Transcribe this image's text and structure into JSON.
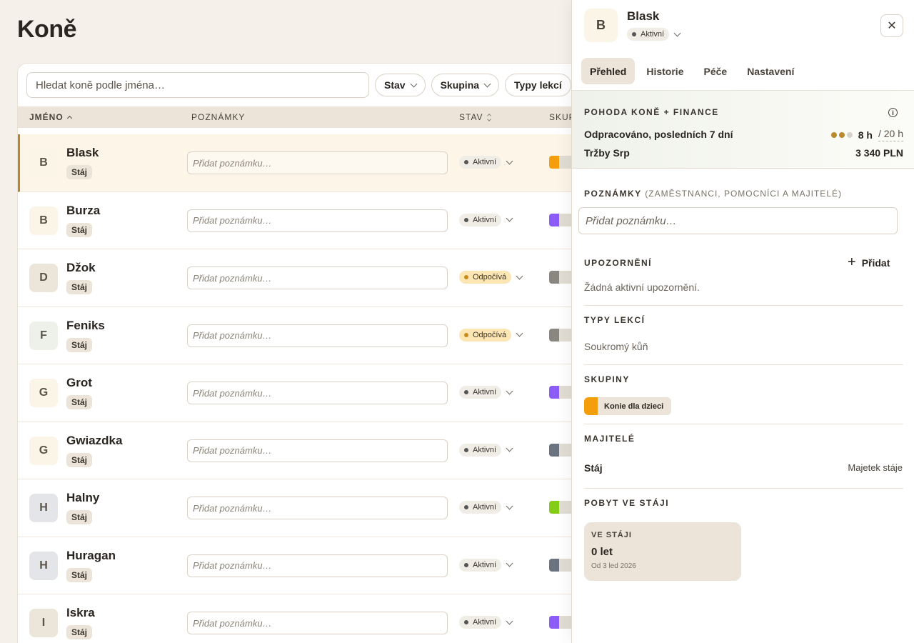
{
  "page": {
    "title": "Koně"
  },
  "toolbar": {
    "search_placeholder": "Hledat koně podle jména…",
    "filters": [
      "Stav",
      "Skupina",
      "Typy lekcí"
    ]
  },
  "table": {
    "headers": {
      "name": "JMÉNO",
      "notes": "POZNÁMKY",
      "status": "STAV",
      "group": "SKUP"
    },
    "note_placeholder": "Přidat poznámku…",
    "rows": [
      {
        "initial": "B",
        "name": "Blask",
        "tag": "Stáj",
        "status": "Aktivní",
        "status_kind": "active",
        "avatar_color": "#fbf5e7",
        "group_color": "#f59e0b",
        "selected": true
      },
      {
        "initial": "B",
        "name": "Burza",
        "tag": "Stáj",
        "status": "Aktivní",
        "status_kind": "active",
        "avatar_color": "#fbf5e7",
        "group_color": "#8b5cf6",
        "selected": false
      },
      {
        "initial": "D",
        "name": "Džok",
        "tag": "Stáj",
        "status": "Odpočívá",
        "status_kind": "rest",
        "avatar_color": "#ebe5da",
        "group_color": "#8a8680",
        "selected": false
      },
      {
        "initial": "F",
        "name": "Feniks",
        "tag": "Stáj",
        "status": "Odpočívá",
        "status_kind": "rest",
        "avatar_color": "#eef1ea",
        "group_color": "#8a8680",
        "selected": false
      },
      {
        "initial": "G",
        "name": "Grot",
        "tag": "Stáj",
        "status": "Aktivní",
        "status_kind": "active",
        "avatar_color": "#fbf5e7",
        "group_color": "#8b5cf6",
        "selected": false
      },
      {
        "initial": "G",
        "name": "Gwiazdka",
        "tag": "Stáj",
        "status": "Aktivní",
        "status_kind": "active",
        "avatar_color": "#fbf5e7",
        "group_color": "#6b7280",
        "selected": false
      },
      {
        "initial": "H",
        "name": "Halny",
        "tag": "Stáj",
        "status": "Aktivní",
        "status_kind": "active",
        "avatar_color": "#e3e5e8",
        "group_color": "#84cc16",
        "selected": false
      },
      {
        "initial": "H",
        "name": "Huragan",
        "tag": "Stáj",
        "status": "Aktivní",
        "status_kind": "active",
        "avatar_color": "#e3e5e8",
        "group_color": "#6b7280",
        "selected": false
      },
      {
        "initial": "I",
        "name": "Iskra",
        "tag": "Stáj",
        "status": "Aktivní",
        "status_kind": "active",
        "avatar_color": "#ebe5da",
        "group_color": "#8b5cf6",
        "selected": false
      }
    ]
  },
  "panel": {
    "initial": "B",
    "name": "Blask",
    "status": "Aktivní",
    "close": "✕",
    "tabs": [
      "Přehled",
      "Historie",
      "Péče",
      "Nastavení"
    ],
    "finance": {
      "title": "POHODA KONĚ + FINANCE",
      "worked_label": "Odpracováno, posledních 7 dní",
      "worked_value": "8 h",
      "worked_of": "/ 20 h",
      "sales_label": "Tržby Srp",
      "sales_value": "3 340 PLN"
    },
    "notes": {
      "title": "POZNÁMKY",
      "subtitle": "(ZAMĚSTNANCI, POMOCNÍCI A MAJITELÉ)",
      "placeholder": "Přidat poznámku…"
    },
    "alerts": {
      "title": "UPOZORNĚNÍ",
      "add_label": "Přidat",
      "empty": "Žádná aktivní upozornění."
    },
    "lesson_types": {
      "title": "TYPY LEKCÍ",
      "value": "Soukromý kůň"
    },
    "groups": {
      "title": "SKUPINY",
      "items": [
        {
          "label": "Konie dla dzieci",
          "color": "#f59e0b"
        }
      ]
    },
    "owners": {
      "title": "MAJITELÉ",
      "name": "Stáj",
      "type": "Majetek stáje"
    },
    "stay": {
      "title": "POBYT VE STÁJI",
      "card_label": "VE STÁJI",
      "value": "0 let",
      "since": "Od 3 led 2026"
    }
  }
}
